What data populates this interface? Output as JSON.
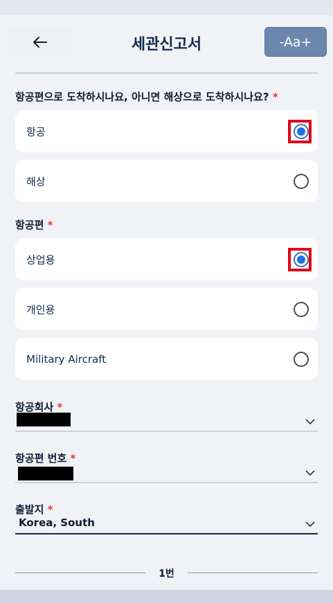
{
  "header": {
    "title": "세관신고서",
    "font_size_label": "-Aa+"
  },
  "arrival": {
    "question": "항공편으로 도착하시나요, 아니면 해상으로 도착하시나요?",
    "required_mark": "*",
    "options": [
      {
        "label": "항공",
        "selected": true
      },
      {
        "label": "해상",
        "selected": false
      }
    ]
  },
  "flight_type": {
    "question": "항공편",
    "required_mark": "*",
    "options": [
      {
        "label": "상업용",
        "selected": true
      },
      {
        "label": "개인용",
        "selected": false
      },
      {
        "label": "Military Aircraft",
        "selected": false
      }
    ]
  },
  "fields": {
    "airline": {
      "label": "항공회사",
      "required_mark": "*"
    },
    "flight_number": {
      "label": "항공편 번호",
      "required_mark": "*"
    },
    "origin": {
      "label": "출발지",
      "required_mark": "*",
      "value": "Korea, South"
    }
  },
  "pagination": {
    "label": "1번"
  },
  "colors": {
    "accent": "#1a73e8",
    "highlight": "#e0001b",
    "brand": "#10294d"
  }
}
